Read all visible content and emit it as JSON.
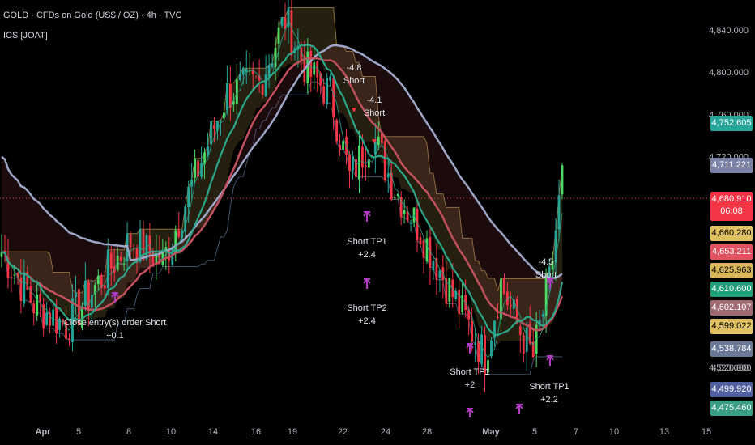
{
  "header": {
    "title": "GOLD · CFDs on Gold (US$ / OZ) · 4h · TVC",
    "indicator": "ICS [JOAT]"
  },
  "price_axis": {
    "labels": [
      "4,840.000",
      "4,800.000",
      "4,760.000",
      "4,720.000",
      "4,680.000",
      "4,640.000",
      "4,600.000",
      "4,560.000",
      "4,520.000"
    ]
  },
  "time_axis": {
    "labels": [
      "Apr",
      "5",
      "8",
      "10",
      "14",
      "16",
      "19",
      "22",
      "24",
      "28",
      "May",
      "5",
      "7",
      "10",
      "13",
      "15"
    ]
  },
  "badges": [
    {
      "id": "badge-1",
      "value": "4,752.605",
      "color": "#26a69a"
    },
    {
      "id": "badge-2",
      "value": "4,711.221",
      "color": "#7b84a6"
    },
    {
      "id": "badge-3",
      "value": "4,680.910",
      "sub": "06:08",
      "color": "#f23645"
    },
    {
      "id": "badge-4",
      "value": "4,660.280",
      "color": "#e0c060",
      "text_color": "#000000"
    },
    {
      "id": "badge-5",
      "value": "4,653.211",
      "color": "#e05260"
    },
    {
      "id": "badge-6",
      "value": "4,625.963",
      "color": "#d8b85a",
      "text_color": "#000000"
    },
    {
      "id": "badge-7",
      "value": "4,610.600",
      "color": "#1f9e7a"
    },
    {
      "id": "badge-8",
      "value": "4,602.107",
      "color": "#9e6a70"
    },
    {
      "id": "badge-9",
      "value": "4,599.022",
      "color": "#e0c060",
      "text_color": "#000000"
    },
    {
      "id": "badge-10",
      "value": "4,538.784",
      "color": "#6a7898"
    },
    {
      "id": "badge-11",
      "value": "4,520.000",
      "color": "transparent",
      "text_color": "#b2b5be"
    },
    {
      "id": "badge-12",
      "value": "4,499.920",
      "color": "#5060a0"
    },
    {
      "id": "badge-13",
      "value": "4,475.460",
      "color": "#3a9e86"
    }
  ],
  "annotations": [
    {
      "id": "ann-short-1",
      "lines": [
        "-4.8",
        "Short"
      ]
    },
    {
      "id": "ann-short-2",
      "lines": [
        "-4.1",
        "Short"
      ]
    },
    {
      "id": "ann-short-tp1-1",
      "lines": [
        "Short TP1",
        "+2.4"
      ]
    },
    {
      "id": "ann-short-tp2",
      "lines": [
        "Short TP2",
        "+2.4"
      ]
    },
    {
      "id": "ann-close-entry",
      "lines": [
        "Close entry(s) order Short",
        "+0.1"
      ]
    },
    {
      "id": "ann-short-tp1-2",
      "lines": [
        "Short TP1",
        "+2"
      ]
    },
    {
      "id": "ann-short-3",
      "lines": [
        "-4.5",
        "Short"
      ]
    },
    {
      "id": "ann-short-tp1-3",
      "lines": [
        "Short TP1",
        "+2.2"
      ]
    }
  ],
  "colors": {
    "up": "#26a69a",
    "down": "#f23645",
    "upbright": "#4cd964",
    "ma_slow": "#9ea6c7",
    "ma_mid": "#c2505e",
    "ma_fast": "#2ba68a",
    "band": "#e0c060",
    "marker": "#b03ac0"
  }
}
